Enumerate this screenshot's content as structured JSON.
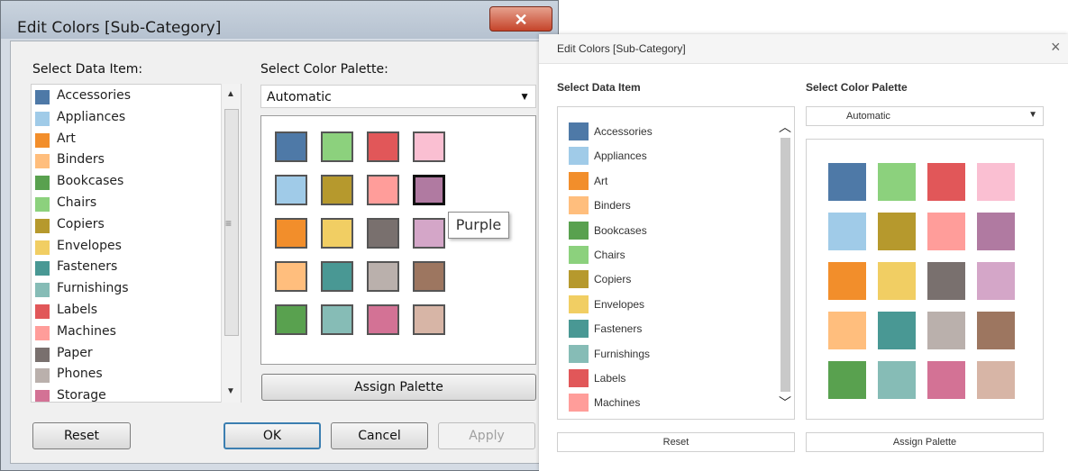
{
  "old_dialog": {
    "title": "Edit Colors [Sub-Category]",
    "close_icon": "close-icon",
    "select_data_item_label": "Select Data Item:",
    "select_palette_label": "Select Color Palette:",
    "palette_value": "Automatic",
    "items": [
      {
        "label": "Accessories",
        "color": "#4e79a7"
      },
      {
        "label": "Appliances",
        "color": "#a0cbe8"
      },
      {
        "label": "Art",
        "color": "#f28e2b"
      },
      {
        "label": "Binders",
        "color": "#ffbe7d"
      },
      {
        "label": "Bookcases",
        "color": "#59a14f"
      },
      {
        "label": "Chairs",
        "color": "#8cd17d"
      },
      {
        "label": "Copiers",
        "color": "#b6992d"
      },
      {
        "label": "Envelopes",
        "color": "#f1ce63"
      },
      {
        "label": "Fasteners",
        "color": "#499894"
      },
      {
        "label": "Furnishings",
        "color": "#86bcb6"
      },
      {
        "label": "Labels",
        "color": "#e15759"
      },
      {
        "label": "Machines",
        "color": "#ff9d9a"
      },
      {
        "label": "Paper",
        "color": "#79706e"
      },
      {
        "label": "Phones",
        "color": "#bab0ac"
      },
      {
        "label": "Storage",
        "color": "#d37295"
      }
    ],
    "tooltip": "Purple",
    "assign_palette_label": "Assign Palette",
    "reset_label": "Reset",
    "ok_label": "OK",
    "cancel_label": "Cancel",
    "apply_label": "Apply"
  },
  "palette_colors": [
    [
      "#4e79a7",
      "#8cd17d",
      "#e15759",
      "#fabfd2"
    ],
    [
      "#a0cbe8",
      "#b6992d",
      "#ff9d9a",
      "#b07aa1"
    ],
    [
      "#f28e2b",
      "#f1ce63",
      "#79706e",
      "#d4a6c8"
    ],
    [
      "#ffbe7d",
      "#499894",
      "#bab0ac",
      "#9d7660"
    ],
    [
      "#59a14f",
      "#86bcb6",
      "#d37295",
      "#d7b5a6"
    ]
  ],
  "new_dialog": {
    "title": "Edit Colors [Sub-Category]",
    "close_glyph": "×",
    "select_data_item_label": "Select Data Item",
    "select_palette_label": "Select Color Palette",
    "palette_value": "Automatic",
    "items": [
      {
        "label": "Accessories",
        "color": "#4e79a7"
      },
      {
        "label": "Appliances",
        "color": "#a0cbe8"
      },
      {
        "label": "Art",
        "color": "#f28e2b"
      },
      {
        "label": "Binders",
        "color": "#ffbe7d"
      },
      {
        "label": "Bookcases",
        "color": "#59a14f"
      },
      {
        "label": "Chairs",
        "color": "#8cd17d"
      },
      {
        "label": "Copiers",
        "color": "#b6992d"
      },
      {
        "label": "Envelopes",
        "color": "#f1ce63"
      },
      {
        "label": "Fasteners",
        "color": "#499894"
      },
      {
        "label": "Furnishings",
        "color": "#86bcb6"
      },
      {
        "label": "Labels",
        "color": "#e15759"
      },
      {
        "label": "Machines",
        "color": "#ff9d9a"
      }
    ],
    "reset_label": "Reset",
    "assign_palette_label": "Assign Palette"
  }
}
